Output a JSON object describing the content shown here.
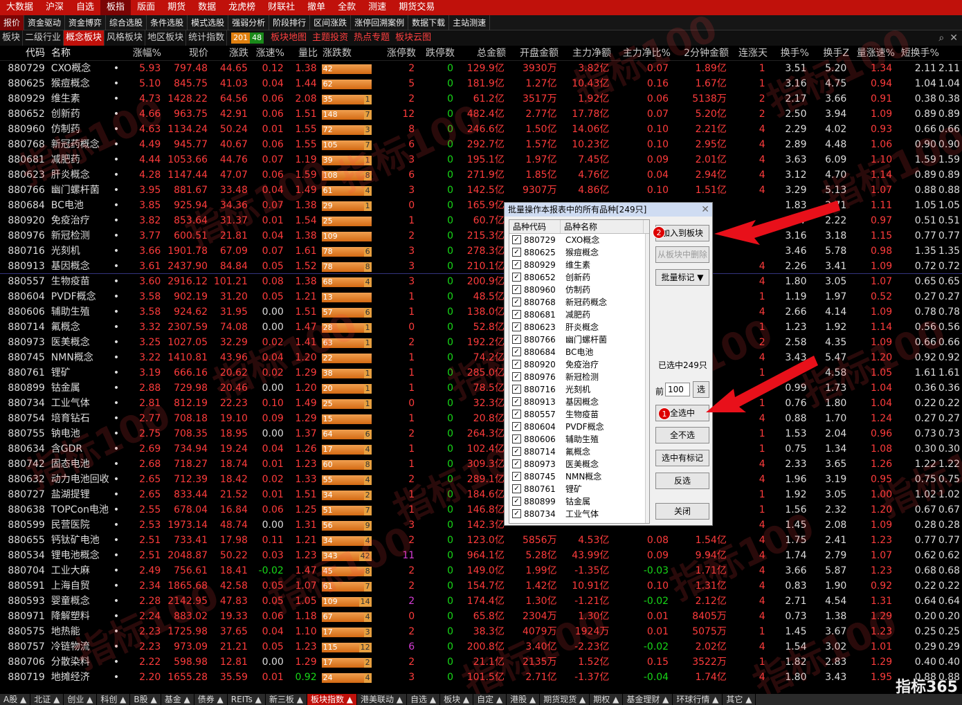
{
  "top_menu": [
    "大数据",
    "沪深",
    "自选",
    "板指",
    "版面",
    "期货",
    "数据",
    "龙虎榜",
    "财联社",
    "撤单",
    "全款",
    "测速",
    "期货交易"
  ],
  "sub_nav": [
    "报价",
    "资金驱动",
    "资金博弈",
    "综合选股",
    "条件选股",
    "模式选股",
    "强弱分析",
    "阶段排行",
    "区间涨跌",
    "涨停回溯案例",
    "数据下载",
    "主站测速"
  ],
  "tabs": {
    "items": [
      "板块",
      "二级行业",
      "概念板块",
      "风格板块",
      "地区板块",
      "统计指数"
    ],
    "up_count": "201",
    "down_count": "48",
    "links": [
      "板块地图",
      "主题投资",
      "热点专题",
      "板块云图"
    ]
  },
  "columns": [
    "代码",
    "名称",
    "",
    "涨幅%",
    "现价",
    "涨跌",
    "涨速%",
    "量比",
    "涨跌数",
    "涨停数",
    "跌停数",
    "总金额",
    "开盘金额",
    "主力净额",
    "主力净比%",
    "2分钟金额",
    "连涨天",
    "换手%",
    "换手Z",
    "量涨速%",
    "短换手%"
  ],
  "rows": [
    [
      "880729",
      "CXO概念",
      "5.93",
      "797.48",
      "44.65",
      "0.12",
      "1.38",
      "42",
      "",
      "2",
      "0",
      "129.9亿",
      "3930万",
      "3.82亿",
      "0.07",
      "1.89亿",
      "1",
      "3.51",
      "5.20",
      "1.34",
      "2.11"
    ],
    [
      "880625",
      "猴痘概念",
      "5.10",
      "845.75",
      "41.03",
      "0.04",
      "1.44",
      "62",
      "",
      "5",
      "0",
      "181.9亿",
      "1.27亿",
      "10.43亿",
      "0.16",
      "1.67亿",
      "1",
      "3.16",
      "4.75",
      "0.94",
      "1.04"
    ],
    [
      "880929",
      "维生素",
      "4.73",
      "1428.22",
      "64.56",
      "0.06",
      "2.08",
      "35",
      "1",
      "2",
      "0",
      "61.2亿",
      "3517万",
      "1.92亿",
      "0.06",
      "5138万",
      "2",
      "2.17",
      "3.66",
      "0.91",
      "0.38"
    ],
    [
      "880652",
      "创新药",
      "4.66",
      "963.75",
      "42.91",
      "0.06",
      "1.51",
      "148",
      "7",
      "12",
      "0",
      "482.4亿",
      "2.77亿",
      "17.78亿",
      "0.07",
      "5.20亿",
      "2",
      "2.50",
      "3.94",
      "1.09",
      "0.89"
    ],
    [
      "880960",
      "仿制药",
      "4.63",
      "1134.24",
      "50.24",
      "0.01",
      "1.55",
      "72",
      "3",
      "8",
      "0",
      "246.6亿",
      "1.50亿",
      "14.06亿",
      "0.10",
      "2.21亿",
      "4",
      "2.29",
      "4.02",
      "0.93",
      "0.66"
    ],
    [
      "880768",
      "新冠药概念",
      "4.49",
      "945.77",
      "40.67",
      "0.06",
      "1.55",
      "105",
      "7",
      "6",
      "0",
      "292.7亿",
      "1.57亿",
      "10.23亿",
      "0.10",
      "2.95亿",
      "4",
      "2.89",
      "4.48",
      "1.06",
      "0.90"
    ],
    [
      "880681",
      "减肥药",
      "4.44",
      "1053.66",
      "44.76",
      "0.07",
      "1.19",
      "39",
      "1",
      "3",
      "0",
      "195.1亿",
      "1.97亿",
      "7.45亿",
      "0.09",
      "2.01亿",
      "4",
      "3.63",
      "6.09",
      "1.10",
      "1.59"
    ],
    [
      "880623",
      "肝炎概念",
      "4.28",
      "1147.44",
      "47.07",
      "0.06",
      "1.59",
      "108",
      "8",
      "6",
      "0",
      "271.9亿",
      "1.85亿",
      "4.76亿",
      "0.04",
      "2.94亿",
      "4",
      "3.12",
      "4.70",
      "1.14",
      "0.89"
    ],
    [
      "880766",
      "幽门螺杆菌",
      "3.95",
      "881.67",
      "33.48",
      "0.04",
      "1.49",
      "61",
      "4",
      "3",
      "0",
      "142.5亿",
      "9307万",
      "4.86亿",
      "0.10",
      "1.51亿",
      "4",
      "3.29",
      "5.13",
      "1.07",
      "0.88"
    ],
    [
      "880684",
      "BC电池",
      "3.85",
      "925.94",
      "34.36",
      "0.07",
      "1.38",
      "29",
      "1",
      "0",
      "0",
      "165.9亿",
      "",
      "",
      "",
      "",
      "",
      "1.83",
      "2.71",
      "1.11",
      "1.05"
    ],
    [
      "880920",
      "免疫治疗",
      "3.82",
      "853.64",
      "31.37",
      "0.01",
      "1.54",
      "25",
      "",
      "1",
      "0",
      "60.7亿",
      "",
      "",
      "",
      "",
      "",
      "1.47",
      "2.22",
      "0.97",
      "0.51"
    ],
    [
      "880976",
      "新冠检测",
      "3.77",
      "600.51",
      "21.81",
      "0.04",
      "1.38",
      "109",
      "",
      "2",
      "0",
      "215.3亿",
      "",
      "",
      "",
      "",
      "",
      "3.16",
      "3.18",
      "1.15",
      "0.77"
    ],
    [
      "880716",
      "光刻机",
      "3.66",
      "1901.78",
      "67.09",
      "0.07",
      "1.61",
      "78",
      "6",
      "3",
      "0",
      "278.3亿",
      "",
      "",
      "",
      "",
      "",
      "3.46",
      "5.78",
      "0.98",
      "1.35"
    ],
    [
      "880913",
      "基因概念",
      "3.61",
      "2437.90",
      "84.84",
      "0.05",
      "1.52",
      "78",
      "8",
      "3",
      "0",
      "210.1亿",
      "",
      "",
      "",
      "",
      "4",
      "2.26",
      "3.41",
      "1.09",
      "0.72"
    ],
    [
      "880557",
      "生物疫苗",
      "3.60",
      "2916.12",
      "101.21",
      "0.08",
      "1.38",
      "68",
      "4",
      "3",
      "0",
      "200.9亿",
      "",
      "",
      "",
      "",
      "4",
      "1.80",
      "3.05",
      "1.07",
      "0.65"
    ],
    [
      "880604",
      "PVDF概念",
      "3.58",
      "902.19",
      "31.20",
      "0.05",
      "1.21",
      "13",
      "",
      "1",
      "0",
      "48.5亿",
      "",
      "",
      "",
      "",
      "1",
      "1.19",
      "1.97",
      "0.52",
      "0.27"
    ],
    [
      "880606",
      "辅助生殖",
      "3.58",
      "924.62",
      "31.95",
      "0.00",
      "1.51",
      "57",
      "6",
      "1",
      "0",
      "138.0亿",
      "",
      "",
      "",
      "",
      "4",
      "2.66",
      "4.14",
      "1.09",
      "0.78"
    ],
    [
      "880714",
      "氟概念",
      "3.32",
      "2307.59",
      "74.08",
      "0.00",
      "1.47",
      "28",
      "1",
      "0",
      "0",
      "52.8亿",
      "",
      "",
      "",
      "",
      "1",
      "1.23",
      "1.92",
      "1.14",
      "0.56"
    ],
    [
      "880973",
      "医美概念",
      "3.25",
      "1027.05",
      "32.29",
      "0.02",
      "1.41",
      "63",
      "1",
      "2",
      "0",
      "192.2亿",
      "",
      "",
      "",
      "",
      "2",
      "2.58",
      "4.35",
      "1.09",
      "0.66"
    ],
    [
      "880745",
      "NMN概念",
      "3.22",
      "1410.81",
      "43.96",
      "0.04",
      "1.20",
      "22",
      "",
      "1",
      "0",
      "74.2亿",
      "",
      "",
      "",
      "",
      "4",
      "3.43",
      "5.47",
      "1.20",
      "0.92"
    ],
    [
      "880761",
      "锂矿",
      "3.19",
      "666.16",
      "20.62",
      "0.02",
      "1.29",
      "38",
      "1",
      "1",
      "0",
      "285.0亿",
      "",
      "",
      "",
      "",
      "1",
      "",
      "4.58",
      "1.05",
      "1.61"
    ],
    [
      "880899",
      "钴金属",
      "2.88",
      "729.98",
      "20.46",
      "0.00",
      "1.20",
      "20",
      "1",
      "1",
      "0",
      "78.5亿",
      "",
      "",
      "",
      "",
      "1",
      "0.99",
      "1.73",
      "1.04",
      "0.36"
    ],
    [
      "880734",
      "工业气体",
      "2.81",
      "812.19",
      "22.23",
      "0.10",
      "1.49",
      "25",
      "1",
      "0",
      "0",
      "32.3亿",
      "",
      "",
      "",
      "",
      "1",
      "0.76",
      "1.80",
      "1.04",
      "0.22"
    ],
    [
      "880754",
      "培育钻石",
      "2.77",
      "708.18",
      "19.10",
      "0.09",
      "1.29",
      "15",
      "",
      "1",
      "0",
      "20.8亿",
      "",
      "",
      "",
      "",
      "4",
      "0.88",
      "1.70",
      "1.24",
      "0.27"
    ],
    [
      "880755",
      "钠电池",
      "2.75",
      "708.35",
      "18.95",
      "0.00",
      "1.37",
      "64",
      "6",
      "2",
      "0",
      "264.3亿",
      "",
      "",
      "",
      "",
      "1",
      "1.53",
      "2.04",
      "0.96",
      "0.73"
    ],
    [
      "880634",
      "含GDR",
      "2.69",
      "734.94",
      "19.24",
      "0.04",
      "1.26",
      "17",
      "4",
      "1",
      "0",
      "102.4亿",
      "",
      "",
      "",
      "",
      "1",
      "0.75",
      "1.34",
      "1.08",
      "0.30"
    ],
    [
      "880742",
      "固态电池",
      "2.68",
      "718.27",
      "18.74",
      "0.01",
      "1.23",
      "60",
      "8",
      "1",
      "0",
      "309.3亿",
      "",
      "",
      "",
      "",
      "4",
      "2.33",
      "3.65",
      "1.26",
      "1.22"
    ],
    [
      "880632",
      "动力电池回收",
      "2.65",
      "712.39",
      "18.42",
      "0.02",
      "1.33",
      "55",
      "4",
      "2",
      "0",
      "289.1亿",
      "",
      "",
      "",
      "",
      "4",
      "1.96",
      "3.19",
      "0.95",
      "0.75"
    ],
    [
      "880727",
      "盐湖提锂",
      "2.65",
      "833.44",
      "21.52",
      "0.01",
      "1.51",
      "34",
      "2",
      "1",
      "0",
      "184.6亿",
      "",
      "",
      "",
      "",
      "1",
      "1.92",
      "3.05",
      "1.00",
      "1.02"
    ],
    [
      "880638",
      "TOPCon电池",
      "2.55",
      "678.04",
      "16.84",
      "0.06",
      "1.25",
      "51",
      "7",
      "1",
      "0",
      "146.8亿",
      "",
      "",
      "",
      "",
      "1",
      "1.56",
      "2.32",
      "1.20",
      "0.67"
    ],
    [
      "880599",
      "民营医院",
      "2.53",
      "1973.14",
      "48.74",
      "0.00",
      "1.31",
      "56",
      "9",
      "3",
      "0",
      "142.3亿",
      "",
      "",
      "",
      "",
      "4",
      "1.45",
      "2.08",
      "1.09",
      "0.28"
    ],
    [
      "880655",
      "钙钛矿电池",
      "2.51",
      "733.41",
      "17.98",
      "0.11",
      "1.21",
      "34",
      "4",
      "2",
      "0",
      "123.0亿",
      "5856万",
      "4.53亿",
      "0.08",
      "1.54亿",
      "4",
      "1.75",
      "2.41",
      "1.23",
      "0.77"
    ],
    [
      "880534",
      "锂电池概念",
      "2.51",
      "2048.87",
      "50.22",
      "0.03",
      "1.23",
      "343",
      "42",
      "11",
      "0",
      "964.1亿",
      "5.28亿",
      "43.99亿",
      "0.09",
      "9.94亿",
      "4",
      "1.74",
      "2.79",
      "1.07",
      "0.62"
    ],
    [
      "880704",
      "工业大麻",
      "2.49",
      "756.61",
      "18.41",
      "-0.02",
      "1.47",
      "45",
      "8",
      "2",
      "0",
      "149.0亿",
      "1.99亿",
      "-1.35亿",
      "-0.03",
      "1.71亿",
      "4",
      "3.66",
      "5.87",
      "1.23",
      "0.68"
    ],
    [
      "880591",
      "上海自贸",
      "2.34",
      "1865.68",
      "42.58",
      "0.05",
      "1.07",
      "61",
      "7",
      "2",
      "0",
      "154.7亿",
      "1.42亿",
      "10.91亿",
      "0.10",
      "1.31亿",
      "4",
      "0.83",
      "1.90",
      "0.92",
      "0.22"
    ],
    [
      "880593",
      "婴童概念",
      "2.28",
      "2142.95",
      "47.83",
      "0.05",
      "1.05",
      "109",
      "14",
      "2",
      "0",
      "174.4亿",
      "1.30亿",
      "-1.21亿",
      "-0.02",
      "2.12亿",
      "4",
      "2.71",
      "4.54",
      "1.31",
      "0.64"
    ],
    [
      "880971",
      "降解塑料",
      "2.24",
      "883.02",
      "19.33",
      "0.06",
      "1.18",
      "67",
      "4",
      "0",
      "0",
      "65.8亿",
      "2304万",
      "1.30亿",
      "0.01",
      "8405万",
      "4",
      "0.73",
      "1.38",
      "1.29",
      "0.20"
    ],
    [
      "880575",
      "地热能",
      "2.23",
      "1725.98",
      "37.65",
      "0.04",
      "1.10",
      "17",
      "3",
      "2",
      "0",
      "38.3亿",
      "4079万",
      "1924万",
      "0.01",
      "5075万",
      "1",
      "1.45",
      "3.67",
      "1.23",
      "0.25"
    ],
    [
      "880757",
      "冷链物流",
      "2.23",
      "973.09",
      "21.21",
      "0.05",
      "1.23",
      "115",
      "12",
      "6",
      "0",
      "200.8亿",
      "3.40亿",
      "-2.23亿",
      "-0.02",
      "2.02亿",
      "4",
      "1.54",
      "3.02",
      "1.01",
      "0.29"
    ],
    [
      "880706",
      "分散染料",
      "2.22",
      "598.98",
      "12.81",
      "0.00",
      "1.29",
      "17",
      "2",
      "2",
      "0",
      "21.1亿",
      "2135万",
      "1.52亿",
      "0.15",
      "3522万",
      "1",
      "1.82",
      "2.83",
      "1.29",
      "0.40"
    ],
    [
      "880719",
      "地摊经济",
      "2.20",
      "1655.28",
      "35.59",
      "0.01",
      "0.92",
      "24",
      "4",
      "3",
      "0",
      "101.5亿",
      "2.71亿",
      "-1.37亿",
      "-0.04",
      "1.74亿",
      "4",
      "1.80",
      "3.43",
      "1.95",
      "0.88"
    ]
  ],
  "dialog": {
    "title": "批量操作本报表中的所有品种[249只]",
    "list_header": [
      "品种代码",
      "品种名称"
    ],
    "items": [
      [
        "880729",
        "CXO概念"
      ],
      [
        "880625",
        "猴痘概念"
      ],
      [
        "880929",
        "维生素"
      ],
      [
        "880652",
        "创新药"
      ],
      [
        "880960",
        "仿制药"
      ],
      [
        "880768",
        "新冠药概念"
      ],
      [
        "880681",
        "减肥药"
      ],
      [
        "880623",
        "肝炎概念"
      ],
      [
        "880766",
        "幽门螺杆菌"
      ],
      [
        "880684",
        "BC电池"
      ],
      [
        "880920",
        "免疫治疗"
      ],
      [
        "880976",
        "新冠检测"
      ],
      [
        "880716",
        "光刻机"
      ],
      [
        "880913",
        "基因概念"
      ],
      [
        "880557",
        "生物疫苗"
      ],
      [
        "880604",
        "PVDF概念"
      ],
      [
        "880606",
        "辅助生殖"
      ],
      [
        "880714",
        "氟概念"
      ],
      [
        "880973",
        "医美概念"
      ],
      [
        "880745",
        "NMN概念"
      ],
      [
        "880761",
        "锂矿"
      ],
      [
        "880899",
        "钴金属"
      ],
      [
        "880734",
        "工业气体"
      ]
    ],
    "btn_add": "加入到板块",
    "btn_remove": "从板块中删除",
    "btn_mark": "批量标记 ▼",
    "selected_text": "已选中249只",
    "pre_label": "前",
    "pre_value": "100",
    "btn_sel": "选",
    "btn_all": "全选中",
    "btn_none": "全不选",
    "btn_marked": "选中有标记",
    "btn_invert": "反选",
    "btn_close": "关闭",
    "badge1": "1",
    "badge2": "2"
  },
  "bottom_tabs": [
    "A股",
    "北证",
    "创业",
    "科创",
    "B股",
    "基金",
    "债券",
    "REITs",
    "新三板",
    "板块指数",
    "港美联动",
    "自选",
    "板块",
    "自定",
    "港股",
    "期货现货",
    "期权",
    "基金理财",
    "环球行情",
    "其它"
  ],
  "brand": "指标365",
  "watermark": "指标100",
  "colors": {
    "up": "#ff3c3c",
    "down": "#18d818",
    "accent": "#c0110b"
  }
}
